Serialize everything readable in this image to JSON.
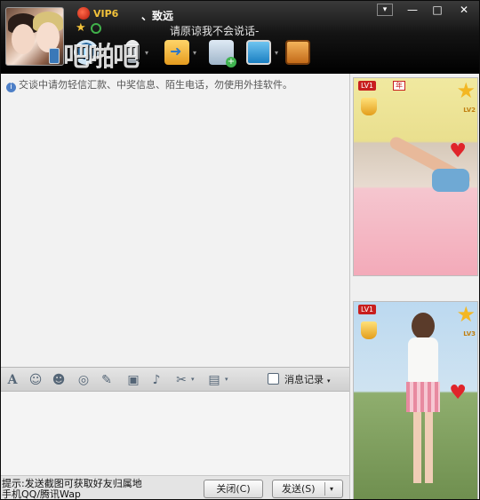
{
  "header": {
    "vip_label": "VIP6",
    "contact_name": "、致远",
    "signature": "请原谅我不会说话-",
    "watermark": "吧啪吧",
    "window_buttons": [
      "▾",
      "—",
      "□",
      "✕"
    ]
  },
  "toolbar_top": {
    "icons": [
      "video-call-icon",
      "voice-call-icon",
      "transfer-file-icon",
      "send-sms-icon",
      "remote-assist-icon",
      "apps-icon"
    ]
  },
  "message_area": {
    "notice": "交谈中请勿轻信汇款、中奖信息、陌生电话，勿使用外挂软件。"
  },
  "input_toolbar": {
    "icons": [
      "font-icon",
      "emoji-icon",
      "magic-face-icon",
      "shake-icon",
      "doodle-icon",
      "image-icon",
      "music-icon",
      "screenshot-icon",
      "briefcase-icon"
    ],
    "history_label": "消息记录"
  },
  "bottom_bar": {
    "hint_line1": "提示:发送截图可获取好友归属地",
    "hint_line2": "手机QQ/腾讯Wap",
    "close_label": "关闭(C)",
    "send_label": "发送(S)"
  },
  "show_panel": {
    "cards": [
      {
        "level_badge": "LV1",
        "year_badge": "年",
        "star_level": "LV2"
      },
      {
        "level_badge": "LV1",
        "star_level": "LV3"
      }
    ]
  },
  "colors": {
    "header_bg": "#000000",
    "vip_gold": "#f2c23a",
    "badge_red": "#c81e1e",
    "panel_bg": "#f2f2f2"
  }
}
